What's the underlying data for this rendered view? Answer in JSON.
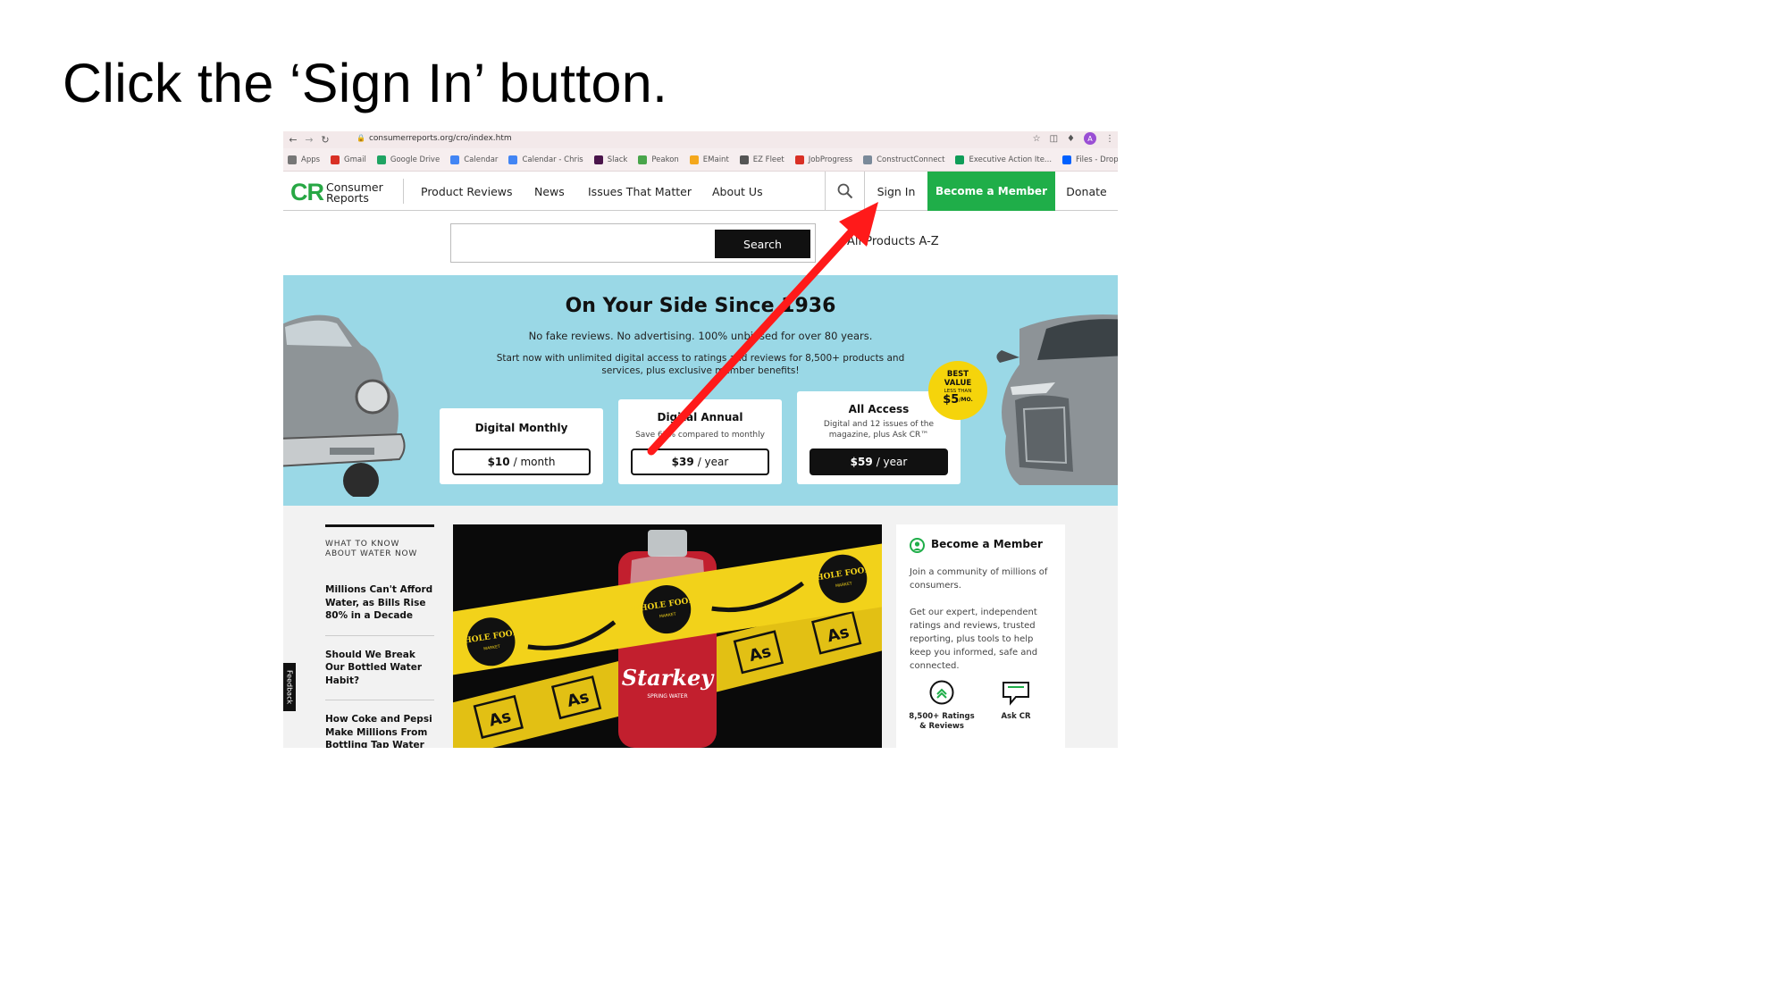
{
  "instruction": "Click the ‘Sign In’ button.",
  "browser": {
    "url": "consumerreports.org/cro/index.htm",
    "profile_initial": "A",
    "bookmarks": [
      {
        "label": "Apps",
        "color": "#777777"
      },
      {
        "label": "Gmail",
        "color": "#d93025"
      },
      {
        "label": "Google Drive",
        "color": "#1fa463"
      },
      {
        "label": "Calendar",
        "color": "#4285f4"
      },
      {
        "label": "Calendar - Chris",
        "color": "#4285f4"
      },
      {
        "label": "Slack",
        "color": "#4a154b"
      },
      {
        "label": "Peakon",
        "color": "#49a54b"
      },
      {
        "label": "EMaint",
        "color": "#f4a81d"
      },
      {
        "label": "EZ Fleet",
        "color": "#555555"
      },
      {
        "label": "JobProgress",
        "color": "#d93025"
      },
      {
        "label": "ConstructConnect",
        "color": "#7a8a9a"
      },
      {
        "label": "Executive Action Ite...",
        "color": "#0f9d58"
      },
      {
        "label": "Files - Dropbox",
        "color": "#0061ff"
      }
    ]
  },
  "site": {
    "logo_mark": "CR",
    "logo_line1": "Consumer",
    "logo_line2": "Reports",
    "nav": [
      "Product Reviews",
      "News",
      "Issues That Matter",
      "About Us"
    ],
    "sign_in": "Sign In",
    "become_member": "Become a Member",
    "donate": "Donate",
    "search_button": "Search",
    "all_products": "All Products A-Z",
    "accent": "#1fae49"
  },
  "hero": {
    "title": "On Your Side Since 1936",
    "subtitle": "No fake reviews. No advertising. 100% unbiased for over 80 years.",
    "description": "Start now with unlimited digital access to ratings and reviews for 8,500+ products and services, plus exclusive member benefits!",
    "background": "#9ad8e6",
    "plans": [
      {
        "name": "Digital Monthly",
        "note": "",
        "price": "$10",
        "period": "/ month"
      },
      {
        "name": "Digital Annual",
        "note": "Save 67% compared to monthly",
        "price": "$39",
        "period": "/ year"
      },
      {
        "name": "All Access",
        "note": "Digital and 12 issues of the magazine, plus Ask CR™",
        "price": "$59",
        "period": "/ year"
      }
    ],
    "badge": {
      "line1": "BEST",
      "line2": "VALUE",
      "line3": "LESS THAN",
      "amount": "$5",
      "unit": "/MO."
    }
  },
  "lower": {
    "kicker": "WHAT TO KNOW ABOUT WATER NOW",
    "articles": [
      "Millions Can't Afford Water, as Bills Rise 80% in a Decade",
      "Should We Break Our Bottled Water Habit?",
      "How Coke and Pepsi Make Millions From Bottling Tap Water"
    ],
    "feedback": "Feedback",
    "image": {
      "brand": "WHOLE FOODS",
      "brand_sub": "MARKET",
      "bottle": "Starkey",
      "bottle_sub": "SPRING WATER",
      "element": "As"
    },
    "side": {
      "title": "Become a Member",
      "p1": "Join a community of millions of consumers.",
      "p2": "Get our expert, independent ratings and reviews, trusted reporting, plus tools to help keep you informed, safe and connected.",
      "feature1": "8,500+ Ratings & Reviews",
      "feature2": "Ask CR"
    }
  },
  "annotation": {
    "color": "#ff1a1a",
    "target": "Sign In"
  }
}
